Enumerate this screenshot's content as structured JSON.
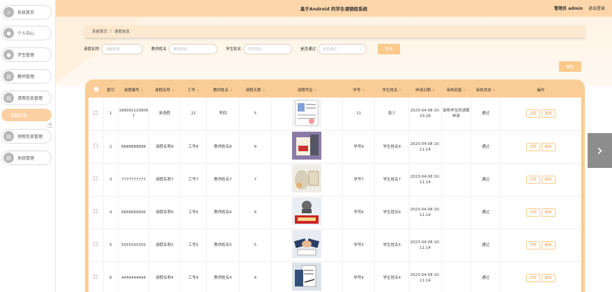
{
  "app": {
    "title": "基于Android 的学生请销假系统",
    "user_label": "管理员 admin",
    "logout": "退出登录"
  },
  "sidebar": {
    "items": [
      {
        "label": "系统首页",
        "icon": "home-icon"
      },
      {
        "label": "个人中心",
        "icon": "user-icon"
      },
      {
        "label": "学生管理",
        "icon": "user-icon"
      },
      {
        "label": "教师管理",
        "icon": "grid-icon"
      },
      {
        "label": "请假信息管理",
        "icon": "grid-icon"
      },
      {
        "label": "销假信息管理",
        "icon": "grid-icon"
      },
      {
        "label": "系统管理",
        "icon": "grid-icon"
      }
    ],
    "active_sub": "请假信息"
  },
  "breadcrumb": {
    "home": "系统首页",
    "sep": "/",
    "current": "请假信息"
  },
  "search": {
    "fields": [
      {
        "label": "请假名称",
        "placeholder": "请假名称"
      },
      {
        "label": "教师姓名",
        "placeholder": "教师姓名"
      },
      {
        "label": "学生姓名",
        "placeholder": "学生姓名"
      },
      {
        "label": "是否通过",
        "placeholder": "是否通过"
      }
    ],
    "button": "查询"
  },
  "batch_delete": "删除",
  "table": {
    "headers": [
      "索引",
      "请假编号",
      "请假名称",
      "工号",
      "教师姓名",
      "请假天数",
      "请假凭证",
      "学号",
      "学生姓名",
      "申请日期",
      "审核回复",
      "审核状态",
      "操作"
    ],
    "rows": [
      {
        "idx": "1",
        "no": "1680921208097",
        "name": "英语假",
        "job": "22",
        "teacher": "李四",
        "days": "5",
        "sid": "11",
        "student": "张三",
        "date": "2023-04-08 10:33:28",
        "reply": "审核学生的请假申请",
        "status": "通过"
      },
      {
        "idx": "2",
        "no": "8888888888",
        "name": "请假名称8",
        "job": "工号8",
        "teacher": "教师姓名8",
        "days": "8",
        "sid": "学号8",
        "student": "学生姓名8",
        "date": "2023-04-08 10:11:14",
        "reply": "",
        "status": "通过"
      },
      {
        "idx": "3",
        "no": "7777777777",
        "name": "请假名称7",
        "job": "工号7",
        "teacher": "教师姓名7",
        "days": "7",
        "sid": "学号7",
        "student": "学生姓名7",
        "date": "2023-04-08 10:11:14",
        "reply": "",
        "status": "通过"
      },
      {
        "idx": "4",
        "no": "6666666666",
        "name": "请假名称6",
        "job": "工号6",
        "teacher": "教师姓名6",
        "days": "6",
        "sid": "学号6",
        "student": "学生姓名6",
        "date": "2023-04-08 10:11:14",
        "reply": "",
        "status": "通过"
      },
      {
        "idx": "5",
        "no": "5555555555",
        "name": "请假名称5",
        "job": "工号5",
        "teacher": "教师姓名5",
        "days": "5",
        "sid": "学号5",
        "student": "学生姓名5",
        "date": "2023-04-08 10:11:14",
        "reply": "",
        "status": "通过"
      },
      {
        "idx": "6",
        "no": "4444444444",
        "name": "请假名称4",
        "job": "工号4",
        "teacher": "教师姓名4",
        "days": "4",
        "sid": "学号4",
        "student": "学生姓名4",
        "date": "2023-04-08 10:11:14",
        "reply": "",
        "status": "通过"
      }
    ],
    "btn_detail": "详情",
    "btn_delete": "删除"
  },
  "colors": {
    "accent": "#fbcd96",
    "header": "#fdd7ab",
    "button": "#fbc98a"
  }
}
